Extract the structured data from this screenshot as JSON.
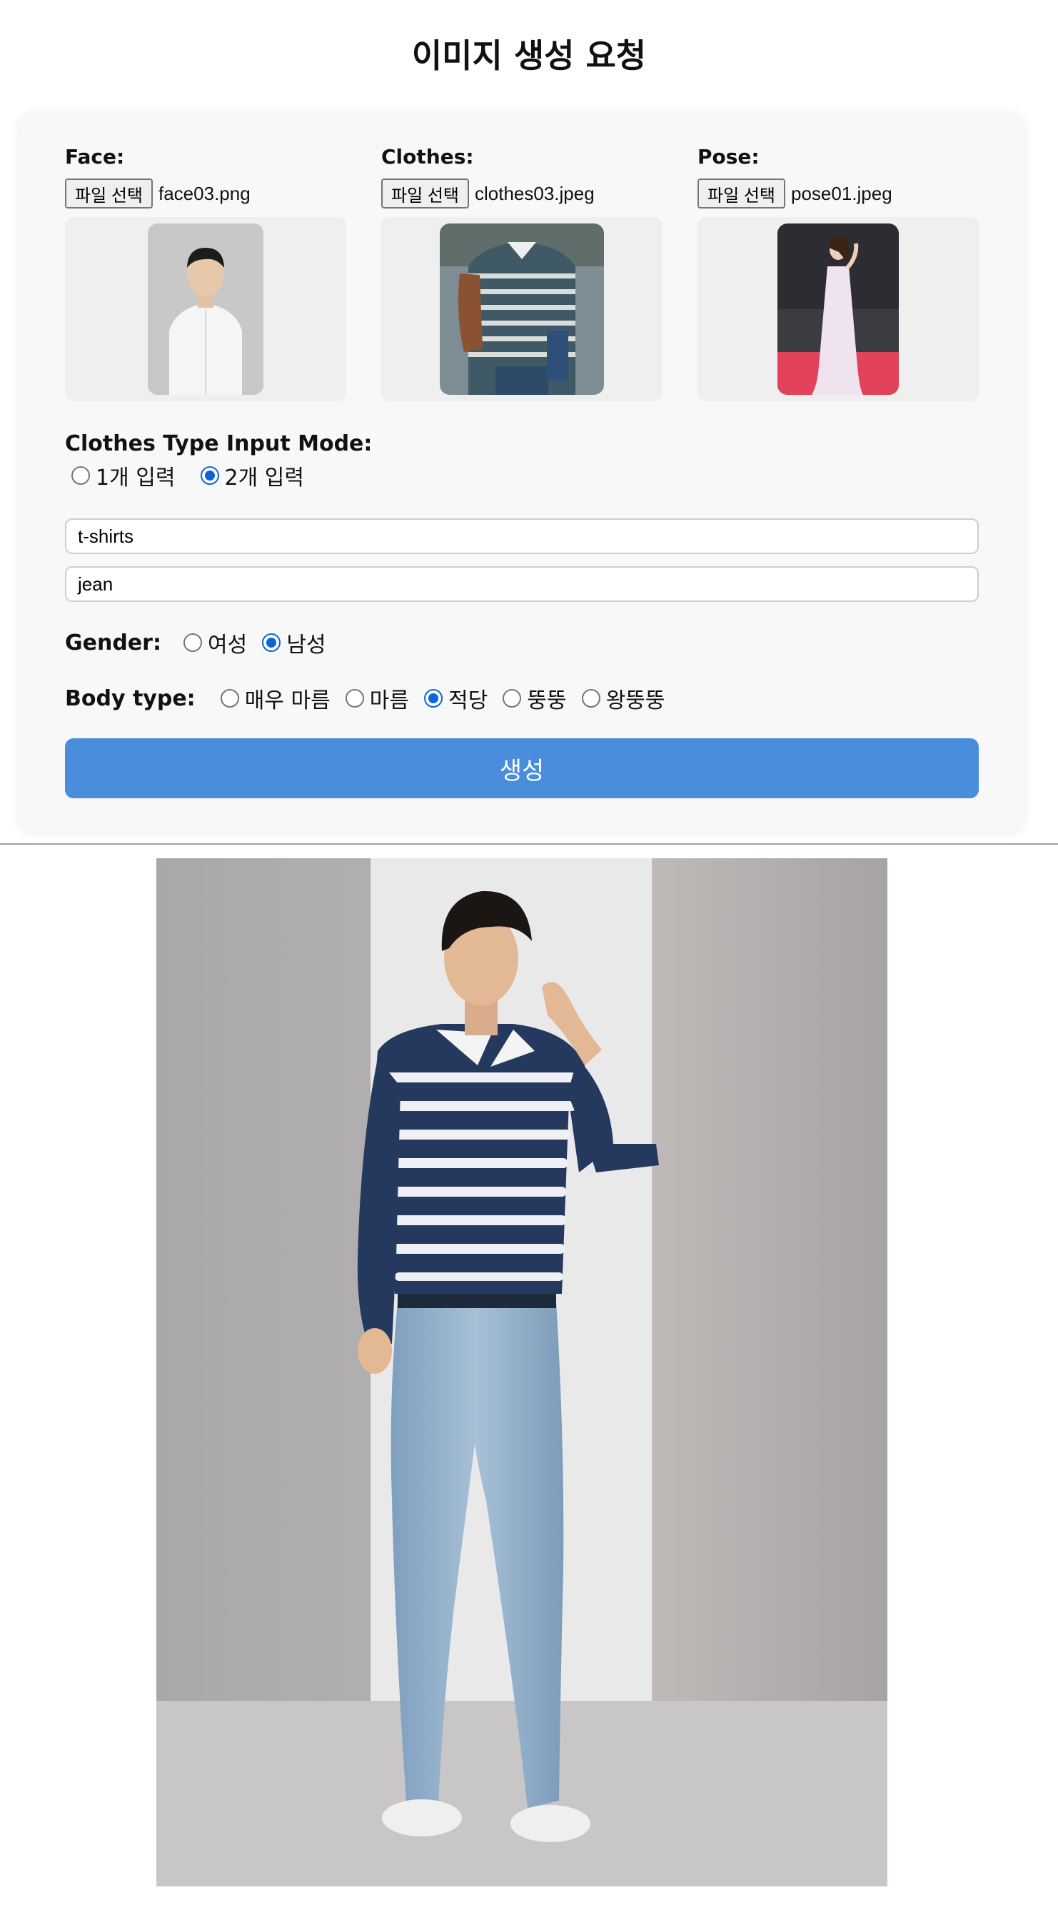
{
  "page_title": "이미지 생성 요청",
  "uploads": [
    {
      "label": "Face:",
      "button": "파일 선택",
      "filename": "face03.png"
    },
    {
      "label": "Clothes:",
      "button": "파일 선택",
      "filename": "clothes03.jpeg"
    },
    {
      "label": "Pose:",
      "button": "파일 선택",
      "filename": "pose01.jpeg"
    }
  ],
  "clothes_mode": {
    "label": "Clothes Type Input Mode:",
    "options": [
      "1개 입력",
      "2개 입력"
    ],
    "selected": "2개 입력"
  },
  "clothes_inputs": [
    "t-shirts",
    "jean"
  ],
  "gender": {
    "label": "Gender:",
    "options": [
      "여성",
      "남성"
    ],
    "selected": "남성"
  },
  "body_type": {
    "label": "Body type:",
    "options": [
      "매우 마름",
      "마름",
      "적당",
      "뚱뚱",
      "왕뚱뚱"
    ],
    "selected": "적당"
  },
  "generate_button": "생성",
  "colors": {
    "accent": "#4a8ddd",
    "radio_selected": "#0a66d8",
    "card_bg": "#f8f8f8"
  }
}
